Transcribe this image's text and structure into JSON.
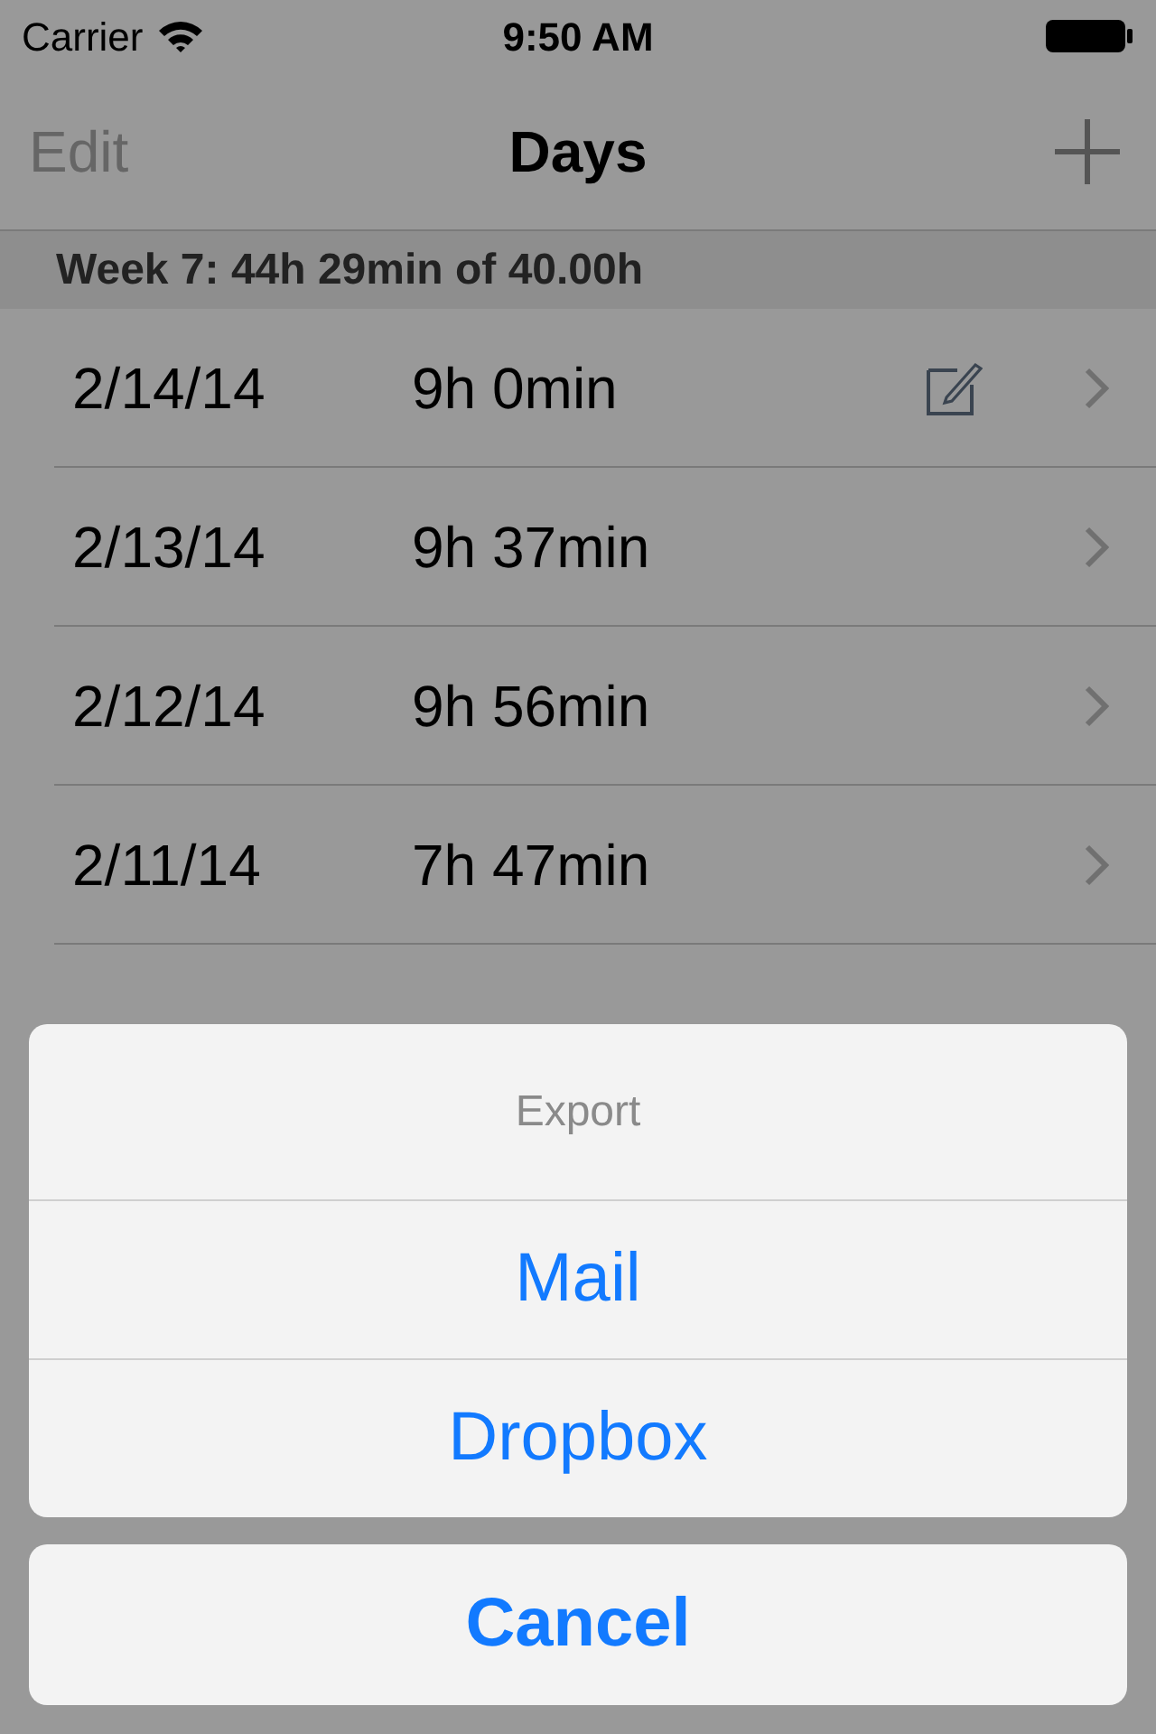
{
  "status_bar": {
    "carrier": "Carrier",
    "time": "9:50 AM"
  },
  "nav_bar": {
    "left": "Edit",
    "title": "Days"
  },
  "sections": [
    {
      "header": "Week 7: 44h 29min of 40.00h",
      "rows": [
        {
          "date": "2/14/14",
          "duration": "9h 0min",
          "note": true
        },
        {
          "date": "2/13/14",
          "duration": "9h 37min",
          "note": false
        },
        {
          "date": "2/12/14",
          "duration": "9h 56min",
          "note": false
        },
        {
          "date": "2/11/14",
          "duration": "7h 47min",
          "note": false
        }
      ]
    }
  ],
  "action_sheet": {
    "title": "Export",
    "options": [
      "Mail",
      "Dropbox"
    ],
    "cancel": "Cancel"
  }
}
